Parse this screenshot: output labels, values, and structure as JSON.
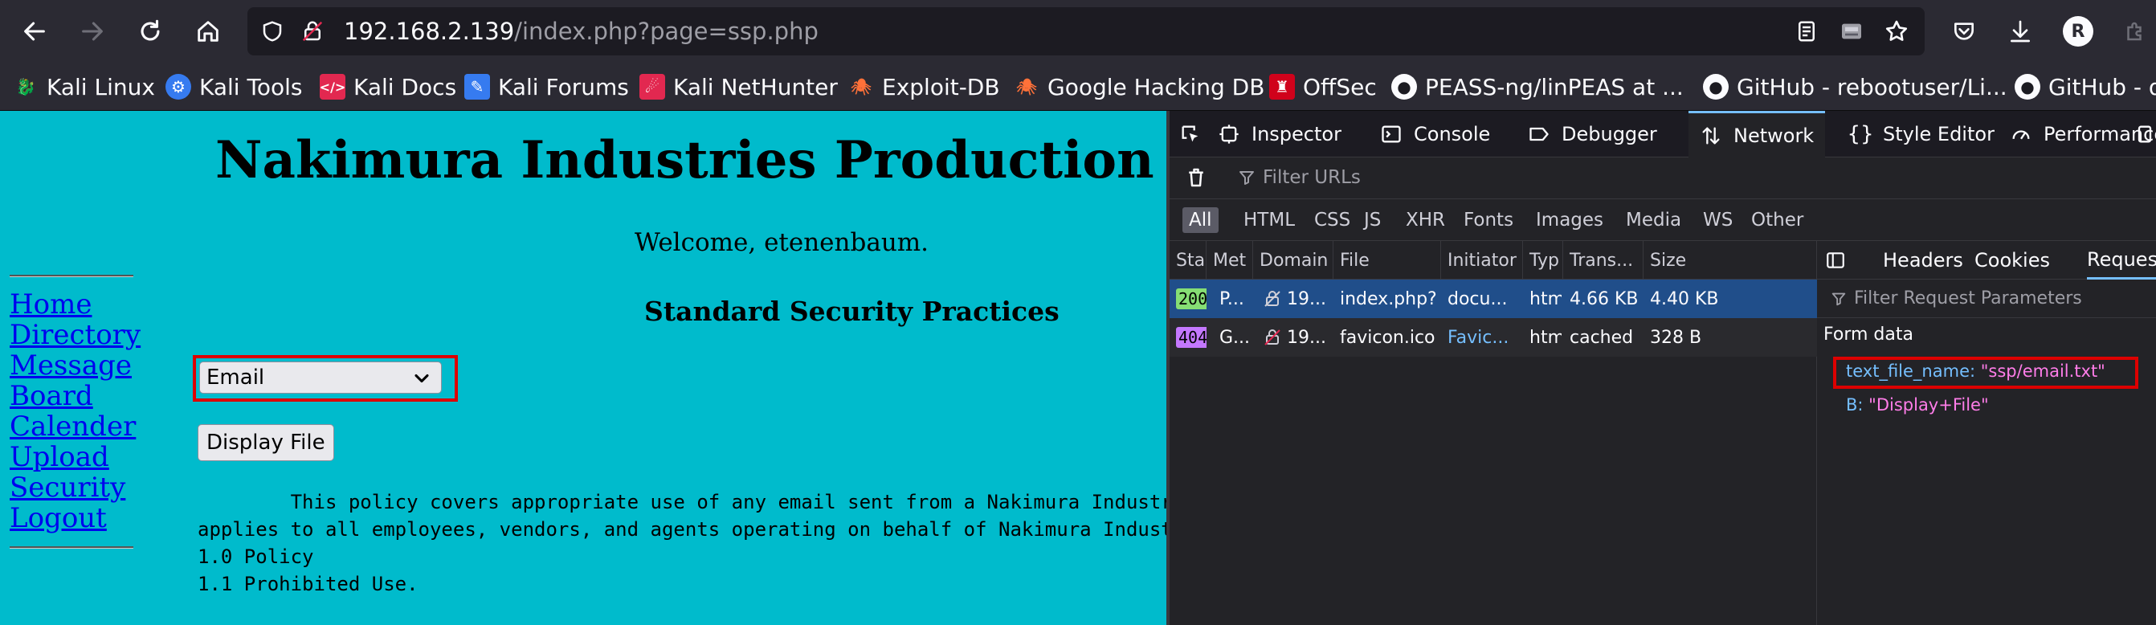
{
  "url": {
    "host": "192.168.2.139",
    "path": "/index.php?page=ssp.php"
  },
  "profile_initial": "R",
  "bookmarks": [
    {
      "label": "Kali Linux",
      "icon": "kali-dragon-icon"
    },
    {
      "label": "Kali Tools",
      "icon": "kali-tools-icon"
    },
    {
      "label": "Kali Docs",
      "icon": "kali-docs-icon"
    },
    {
      "label": "Kali Forums",
      "icon": "kali-forums-icon"
    },
    {
      "label": "Kali NetHunter",
      "icon": "kali-nethunter-icon"
    },
    {
      "label": "Exploit-DB",
      "icon": "exploit-db-icon"
    },
    {
      "label": "Google Hacking DB",
      "icon": "ghdb-icon"
    },
    {
      "label": "OffSec",
      "icon": "offsec-icon"
    },
    {
      "label": "PEASS-ng/linPEAS at ...",
      "icon": "github-icon"
    },
    {
      "label": "GitHub - rebootuser/Li...",
      "icon": "github-icon"
    },
    {
      "label": "GitHub - d",
      "icon": "github-icon"
    }
  ],
  "page": {
    "site_title": "Nakimura Industries Production",
    "welcome": "Welcome, etenenbaum.",
    "section_title": "Standard Security Practices",
    "nav": [
      "Home",
      "Directory",
      "Message",
      "Board",
      "Calender",
      "Upload",
      "Security",
      "Logout"
    ],
    "select_value": "Email",
    "display_button": "Display File",
    "policy_lines": [
      "        This policy covers appropriate use of any email sent from a Nakimura Industr",
      "applies to all employees, vendors, and agents operating on behalf of Nakimura Indust",
      "",
      "1.0 Policy",
      "1.1 Prohibited Use."
    ]
  },
  "devtools": {
    "tabs": [
      "Inspector",
      "Console",
      "Debugger",
      "Network",
      "Style Editor",
      "Performance"
    ],
    "active_tab": "Network",
    "filter_placeholder": "Filter URLs",
    "type_filters": [
      "All",
      "HTML",
      "CSS",
      "JS",
      "XHR",
      "Fonts",
      "Images",
      "Media",
      "WS",
      "Other"
    ],
    "columns": [
      "Sta",
      "Met",
      "Domain",
      "File",
      "Initiator",
      "Typ",
      "Trans...",
      "Size"
    ],
    "requests": [
      {
        "status": "200",
        "method": "P...",
        "domain": "19...",
        "file": "index.php?",
        "initiator": "docu...",
        "type": "htm",
        "transferred": "4.66 KB",
        "size": "4.40 KB"
      },
      {
        "status": "404",
        "method": "G...",
        "domain": "19...",
        "file": "favicon.ico",
        "initiator": "Favic...",
        "type": "htm",
        "transferred": "cached",
        "size": "328 B"
      }
    ],
    "side_tabs": [
      "Headers",
      "Cookies",
      "Request"
    ],
    "params_filter_placeholder": "Filter Request Parameters",
    "form_data_label": "Form data",
    "params": [
      {
        "key": "text_file_name:",
        "value": "\"ssp/email.txt\""
      },
      {
        "key": "B:",
        "value": "\"Display+File\""
      }
    ]
  },
  "colors": {
    "page_bg": "#00bbcc",
    "link": "#0000ee",
    "highlight": "#dd0000",
    "status_200": "#86de74",
    "status_404": "#c478ff",
    "selected_row": "#204e8a"
  }
}
